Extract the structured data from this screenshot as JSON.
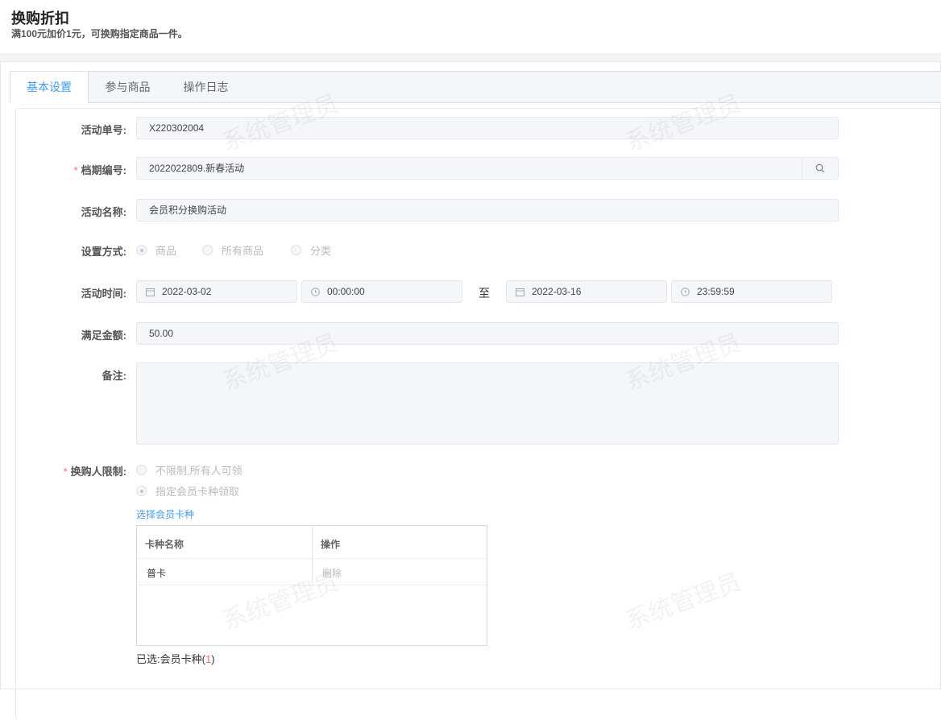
{
  "header": {
    "title": "换购折扣",
    "subtitle": "满100元加价1元，可换购指定商品一件。"
  },
  "tabs": [
    {
      "label": "基本设置",
      "active": true
    },
    {
      "label": "参与商品"
    },
    {
      "label": "操作日志"
    }
  ],
  "form": {
    "order_no": {
      "label": "活动单号:",
      "value": "X220302004"
    },
    "period_no": {
      "label": "档期编号:",
      "value": "2022022809.新春活动"
    },
    "name": {
      "label": "活动名称:",
      "value": "会员积分换购活动"
    },
    "mode": {
      "label": "设置方式:",
      "options": [
        "商品",
        "所有商品",
        "分类"
      ],
      "selected": "商品"
    },
    "time": {
      "label": "活动时间:",
      "start_date": "2022-03-02",
      "start_time": "00:00:00",
      "to": "至",
      "end_date": "2022-03-16",
      "end_time": "23:59:59"
    },
    "amount": {
      "label": "满足金额:",
      "value": "50.00"
    },
    "remark": {
      "label": "备注:",
      "value": ""
    },
    "limit": {
      "label": "换购人限制:",
      "options": [
        "不限制,所有人可领",
        "指定会员卡种领取"
      ],
      "selected": "指定会员卡种领取"
    }
  },
  "card_select": {
    "link": "选择会员卡种",
    "columns": [
      "卡种名称",
      "操作"
    ],
    "rows": [
      {
        "name": "普卡",
        "action": "删除"
      }
    ],
    "summary_prefix": "已选:会员卡种(",
    "count": "1",
    "summary_suffix": ")"
  },
  "watermark": "系统管理员",
  "colors": {
    "accent": "#409eff",
    "required": "#f56c6c"
  }
}
